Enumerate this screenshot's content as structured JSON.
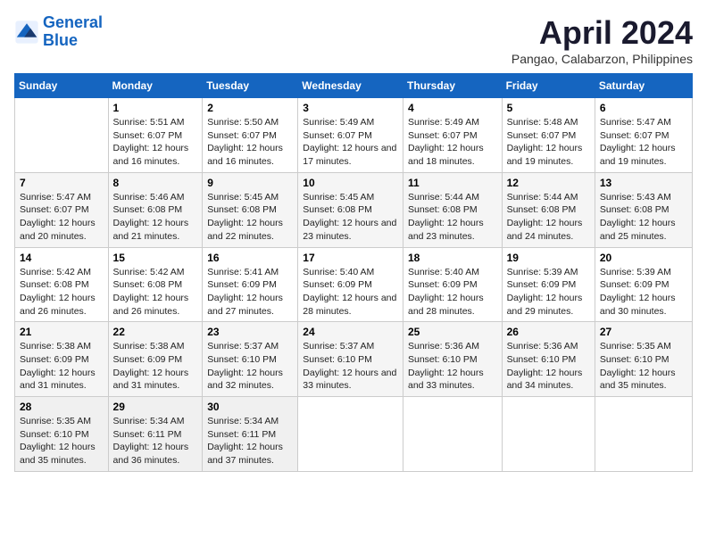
{
  "header": {
    "logo_line1": "General",
    "logo_line2": "Blue",
    "title": "April 2024",
    "location": "Pangao, Calabarzon, Philippines"
  },
  "columns": [
    "Sunday",
    "Monday",
    "Tuesday",
    "Wednesday",
    "Thursday",
    "Friday",
    "Saturday"
  ],
  "weeks": [
    [
      {
        "day": "",
        "sunrise": "",
        "sunset": "",
        "daylight": ""
      },
      {
        "day": "1",
        "sunrise": "Sunrise: 5:51 AM",
        "sunset": "Sunset: 6:07 PM",
        "daylight": "Daylight: 12 hours and 16 minutes."
      },
      {
        "day": "2",
        "sunrise": "Sunrise: 5:50 AM",
        "sunset": "Sunset: 6:07 PM",
        "daylight": "Daylight: 12 hours and 16 minutes."
      },
      {
        "day": "3",
        "sunrise": "Sunrise: 5:49 AM",
        "sunset": "Sunset: 6:07 PM",
        "daylight": "Daylight: 12 hours and 17 minutes."
      },
      {
        "day": "4",
        "sunrise": "Sunrise: 5:49 AM",
        "sunset": "Sunset: 6:07 PM",
        "daylight": "Daylight: 12 hours and 18 minutes."
      },
      {
        "day": "5",
        "sunrise": "Sunrise: 5:48 AM",
        "sunset": "Sunset: 6:07 PM",
        "daylight": "Daylight: 12 hours and 19 minutes."
      },
      {
        "day": "6",
        "sunrise": "Sunrise: 5:47 AM",
        "sunset": "Sunset: 6:07 PM",
        "daylight": "Daylight: 12 hours and 19 minutes."
      }
    ],
    [
      {
        "day": "7",
        "sunrise": "Sunrise: 5:47 AM",
        "sunset": "Sunset: 6:07 PM",
        "daylight": "Daylight: 12 hours and 20 minutes."
      },
      {
        "day": "8",
        "sunrise": "Sunrise: 5:46 AM",
        "sunset": "Sunset: 6:08 PM",
        "daylight": "Daylight: 12 hours and 21 minutes."
      },
      {
        "day": "9",
        "sunrise": "Sunrise: 5:45 AM",
        "sunset": "Sunset: 6:08 PM",
        "daylight": "Daylight: 12 hours and 22 minutes."
      },
      {
        "day": "10",
        "sunrise": "Sunrise: 5:45 AM",
        "sunset": "Sunset: 6:08 PM",
        "daylight": "Daylight: 12 hours and 23 minutes."
      },
      {
        "day": "11",
        "sunrise": "Sunrise: 5:44 AM",
        "sunset": "Sunset: 6:08 PM",
        "daylight": "Daylight: 12 hours and 23 minutes."
      },
      {
        "day": "12",
        "sunrise": "Sunrise: 5:44 AM",
        "sunset": "Sunset: 6:08 PM",
        "daylight": "Daylight: 12 hours and 24 minutes."
      },
      {
        "day": "13",
        "sunrise": "Sunrise: 5:43 AM",
        "sunset": "Sunset: 6:08 PM",
        "daylight": "Daylight: 12 hours and 25 minutes."
      }
    ],
    [
      {
        "day": "14",
        "sunrise": "Sunrise: 5:42 AM",
        "sunset": "Sunset: 6:08 PM",
        "daylight": "Daylight: 12 hours and 26 minutes."
      },
      {
        "day": "15",
        "sunrise": "Sunrise: 5:42 AM",
        "sunset": "Sunset: 6:08 PM",
        "daylight": "Daylight: 12 hours and 26 minutes."
      },
      {
        "day": "16",
        "sunrise": "Sunrise: 5:41 AM",
        "sunset": "Sunset: 6:09 PM",
        "daylight": "Daylight: 12 hours and 27 minutes."
      },
      {
        "day": "17",
        "sunrise": "Sunrise: 5:40 AM",
        "sunset": "Sunset: 6:09 PM",
        "daylight": "Daylight: 12 hours and 28 minutes."
      },
      {
        "day": "18",
        "sunrise": "Sunrise: 5:40 AM",
        "sunset": "Sunset: 6:09 PM",
        "daylight": "Daylight: 12 hours and 28 minutes."
      },
      {
        "day": "19",
        "sunrise": "Sunrise: 5:39 AM",
        "sunset": "Sunset: 6:09 PM",
        "daylight": "Daylight: 12 hours and 29 minutes."
      },
      {
        "day": "20",
        "sunrise": "Sunrise: 5:39 AM",
        "sunset": "Sunset: 6:09 PM",
        "daylight": "Daylight: 12 hours and 30 minutes."
      }
    ],
    [
      {
        "day": "21",
        "sunrise": "Sunrise: 5:38 AM",
        "sunset": "Sunset: 6:09 PM",
        "daylight": "Daylight: 12 hours and 31 minutes."
      },
      {
        "day": "22",
        "sunrise": "Sunrise: 5:38 AM",
        "sunset": "Sunset: 6:09 PM",
        "daylight": "Daylight: 12 hours and 31 minutes."
      },
      {
        "day": "23",
        "sunrise": "Sunrise: 5:37 AM",
        "sunset": "Sunset: 6:10 PM",
        "daylight": "Daylight: 12 hours and 32 minutes."
      },
      {
        "day": "24",
        "sunrise": "Sunrise: 5:37 AM",
        "sunset": "Sunset: 6:10 PM",
        "daylight": "Daylight: 12 hours and 33 minutes."
      },
      {
        "day": "25",
        "sunrise": "Sunrise: 5:36 AM",
        "sunset": "Sunset: 6:10 PM",
        "daylight": "Daylight: 12 hours and 33 minutes."
      },
      {
        "day": "26",
        "sunrise": "Sunrise: 5:36 AM",
        "sunset": "Sunset: 6:10 PM",
        "daylight": "Daylight: 12 hours and 34 minutes."
      },
      {
        "day": "27",
        "sunrise": "Sunrise: 5:35 AM",
        "sunset": "Sunset: 6:10 PM",
        "daylight": "Daylight: 12 hours and 35 minutes."
      }
    ],
    [
      {
        "day": "28",
        "sunrise": "Sunrise: 5:35 AM",
        "sunset": "Sunset: 6:10 PM",
        "daylight": "Daylight: 12 hours and 35 minutes."
      },
      {
        "day": "29",
        "sunrise": "Sunrise: 5:34 AM",
        "sunset": "Sunset: 6:11 PM",
        "daylight": "Daylight: 12 hours and 36 minutes."
      },
      {
        "day": "30",
        "sunrise": "Sunrise: 5:34 AM",
        "sunset": "Sunset: 6:11 PM",
        "daylight": "Daylight: 12 hours and 37 minutes."
      },
      {
        "day": "",
        "sunrise": "",
        "sunset": "",
        "daylight": ""
      },
      {
        "day": "",
        "sunrise": "",
        "sunset": "",
        "daylight": ""
      },
      {
        "day": "",
        "sunrise": "",
        "sunset": "",
        "daylight": ""
      },
      {
        "day": "",
        "sunrise": "",
        "sunset": "",
        "daylight": ""
      }
    ]
  ]
}
